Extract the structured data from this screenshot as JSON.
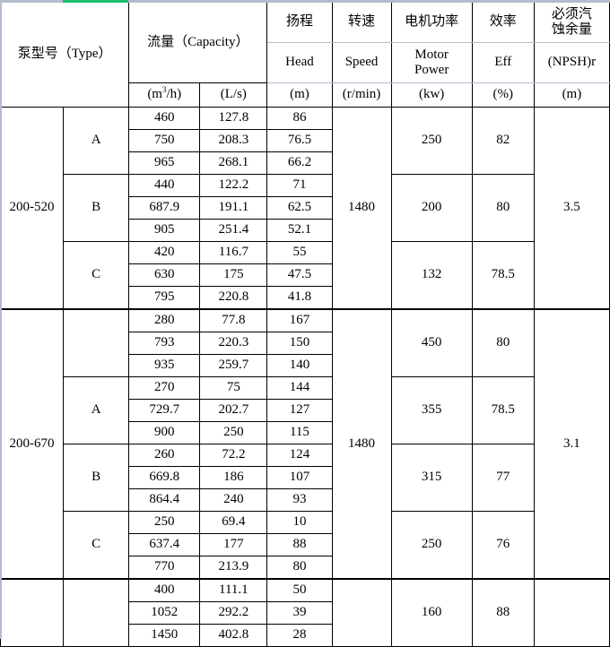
{
  "accent": {
    "green": "#17bf6b",
    "rule": "#b6bacd",
    "border": "#000000"
  },
  "header": {
    "type_label": "泵型号（Type）",
    "capacity_cn": "流量（Capacity）",
    "capacity_units": [
      "(m3/h)",
      "(L/s)"
    ],
    "columns": [
      {
        "cn": "扬程",
        "en": "Head",
        "unit": "(m)"
      },
      {
        "cn": "转速",
        "en": "Speed",
        "unit": "(r/min)"
      },
      {
        "cn": "电机功率",
        "en": "Motor Power",
        "unit": "(kw)"
      },
      {
        "cn": "效率",
        "en": "Eff",
        "unit": "(%)"
      },
      {
        "cn": "必须汽蚀余量",
        "en": "(NPSH)r",
        "unit": "(m)"
      }
    ],
    "capacity_unit_m3h_base": "(m",
    "capacity_unit_m3h_sup": "3",
    "capacity_unit_m3h_tail": "/h)",
    "capacity_unit_ls": "(L/s)",
    "npsh_cn_line1": "必须汽",
    "npsh_cn_line2": "蚀余量",
    "motor_en_line1": "Motor",
    "motor_en_line2": "Power"
  },
  "sections": [
    {
      "type": "200-520",
      "speed": "1480",
      "npsh": "3.5",
      "groups": [
        {
          "letter": "A",
          "motor_power": "250",
          "eff": "82",
          "rows": [
            {
              "m3h": "460",
              "ls": "127.8",
              "head": "86"
            },
            {
              "m3h": "750",
              "ls": "208.3",
              "head": "76.5"
            },
            {
              "m3h": "965",
              "ls": "268.1",
              "head": "66.2"
            }
          ]
        },
        {
          "letter": "B",
          "motor_power": "200",
          "eff": "80",
          "rows": [
            {
              "m3h": "440",
              "ls": "122.2",
              "head": "71"
            },
            {
              "m3h": "687.9",
              "ls": "191.1",
              "head": "62.5"
            },
            {
              "m3h": "905",
              "ls": "251.4",
              "head": "52.1"
            }
          ]
        },
        {
          "letter": "C",
          "motor_power": "132",
          "eff": "78.5",
          "rows": [
            {
              "m3h": "420",
              "ls": "116.7",
              "head": "55"
            },
            {
              "m3h": "630",
              "ls": "175",
              "head": "47.5"
            },
            {
              "m3h": "795",
              "ls": "220.8",
              "head": "41.8"
            }
          ]
        }
      ]
    },
    {
      "type": "200-670",
      "speed": "1480",
      "npsh": "3.1",
      "groups": [
        {
          "letter": "",
          "motor_power": "450",
          "eff": "80",
          "rows": [
            {
              "m3h": "280",
              "ls": "77.8",
              "head": "167"
            },
            {
              "m3h": "793",
              "ls": "220.3",
              "head": "150"
            },
            {
              "m3h": "935",
              "ls": "259.7",
              "head": "140"
            }
          ]
        },
        {
          "letter": "A",
          "motor_power": "355",
          "eff": "78.5",
          "rows": [
            {
              "m3h": "270",
              "ls": "75",
              "head": "144"
            },
            {
              "m3h": "729.7",
              "ls": "202.7",
              "head": "127"
            },
            {
              "m3h": "900",
              "ls": "250",
              "head": "115"
            }
          ]
        },
        {
          "letter": "B",
          "motor_power": "315",
          "eff": "77",
          "rows": [
            {
              "m3h": "260",
              "ls": "72.2",
              "head": "124"
            },
            {
              "m3h": "669.8",
              "ls": "186",
              "head": "107"
            },
            {
              "m3h": "864.4",
              "ls": "240",
              "head": "93"
            }
          ]
        },
        {
          "letter": "C",
          "motor_power": "250",
          "eff": "76",
          "rows": [
            {
              "m3h": "250",
              "ls": "69.4",
              "head": "10"
            },
            {
              "m3h": "637.4",
              "ls": "177",
              "head": "88"
            },
            {
              "m3h": "770",
              "ls": "213.9",
              "head": "80"
            }
          ]
        }
      ]
    },
    {
      "type": "",
      "speed": "",
      "npsh": "",
      "groups": [
        {
          "letter": "",
          "motor_power": "160",
          "eff": "88",
          "rows": [
            {
              "m3h": "400",
              "ls": "111.1",
              "head": "50"
            },
            {
              "m3h": "1052",
              "ls": "292.2",
              "head": "39"
            },
            {
              "m3h": "1450",
              "ls": "402.8",
              "head": "28"
            }
          ]
        }
      ]
    }
  ]
}
